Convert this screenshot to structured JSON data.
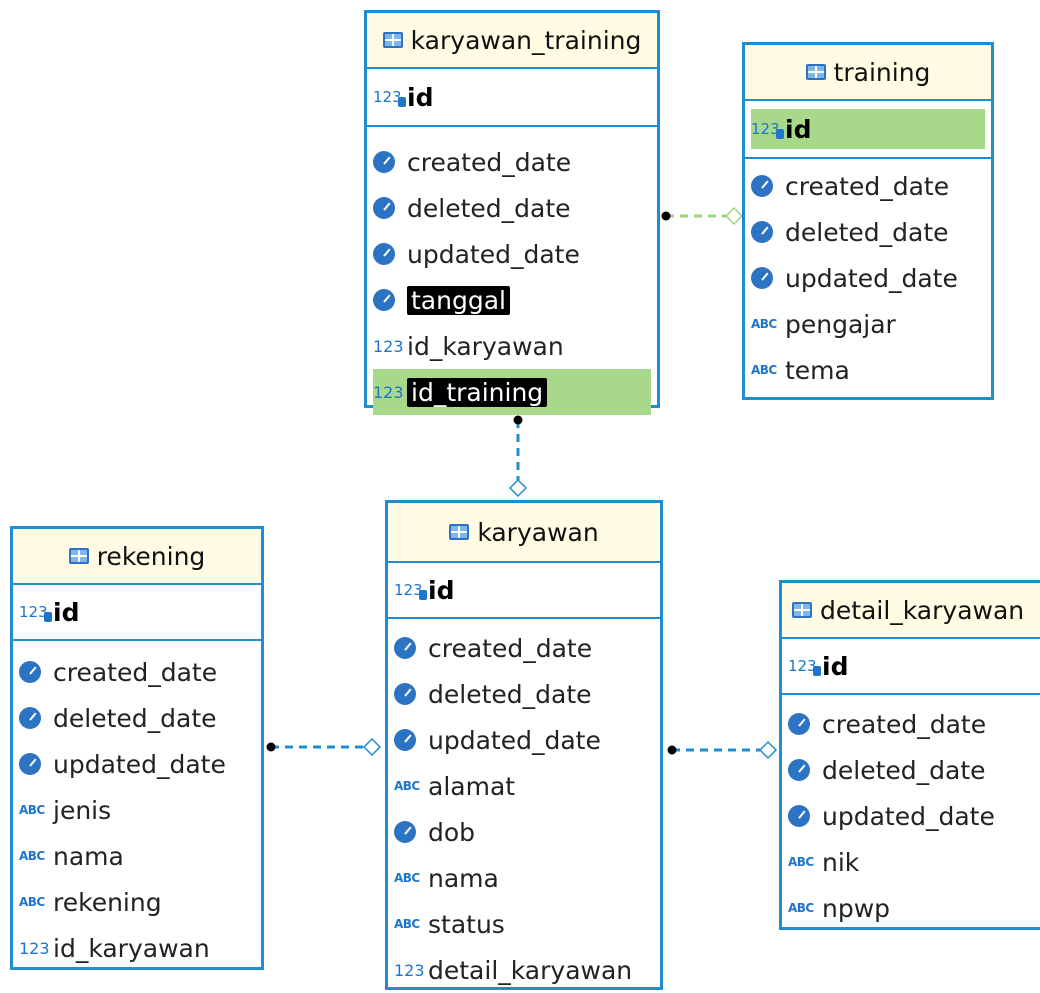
{
  "colors": {
    "border": "#1f8dcf",
    "header_bg": "#fffce3",
    "highlight": "#a8d98b",
    "fk_line": "#1f8dcf",
    "fk_line_green": "#9bd67a"
  },
  "tables": {
    "karyawan_training": {
      "name": "karyawan_training",
      "pk": "id",
      "columns": [
        {
          "name": "created_date",
          "type": "date"
        },
        {
          "name": "deleted_date",
          "type": "date"
        },
        {
          "name": "updated_date",
          "type": "date"
        },
        {
          "name": "tanggal",
          "type": "date"
        },
        {
          "name": "id_karyawan",
          "type": "number"
        },
        {
          "name": "id_training",
          "type": "number"
        }
      ]
    },
    "training": {
      "name": "training",
      "pk": "id",
      "columns": [
        {
          "name": "created_date",
          "type": "date"
        },
        {
          "name": "deleted_date",
          "type": "date"
        },
        {
          "name": "updated_date",
          "type": "date"
        },
        {
          "name": "pengajar",
          "type": "text"
        },
        {
          "name": "tema",
          "type": "text"
        }
      ]
    },
    "rekening": {
      "name": "rekening",
      "pk": "id",
      "columns": [
        {
          "name": "created_date",
          "type": "date"
        },
        {
          "name": "deleted_date",
          "type": "date"
        },
        {
          "name": "updated_date",
          "type": "date"
        },
        {
          "name": "jenis",
          "type": "text"
        },
        {
          "name": "nama",
          "type": "text"
        },
        {
          "name": "rekening",
          "type": "text"
        },
        {
          "name": "id_karyawan",
          "type": "number"
        }
      ]
    },
    "karyawan": {
      "name": "karyawan",
      "pk": "id",
      "columns": [
        {
          "name": "created_date",
          "type": "date"
        },
        {
          "name": "deleted_date",
          "type": "date"
        },
        {
          "name": "updated_date",
          "type": "date"
        },
        {
          "name": "alamat",
          "type": "text"
        },
        {
          "name": "dob",
          "type": "date"
        },
        {
          "name": "nama",
          "type": "text"
        },
        {
          "name": "status",
          "type": "text"
        },
        {
          "name": "detail_karyawan",
          "type": "number"
        }
      ]
    },
    "detail_karyawan": {
      "name": "detail_karyawan",
      "pk": "id",
      "columns": [
        {
          "name": "created_date",
          "type": "date"
        },
        {
          "name": "deleted_date",
          "type": "date"
        },
        {
          "name": "updated_date",
          "type": "date"
        },
        {
          "name": "nik",
          "type": "text"
        },
        {
          "name": "npwp",
          "type": "text"
        }
      ]
    }
  },
  "icons": {
    "table": "table-icon",
    "date": "clock-icon",
    "text": "abc-icon",
    "number": "number-icon",
    "key": "key-icon"
  },
  "icon_text": {
    "abc": "ABC",
    "num": "123"
  }
}
